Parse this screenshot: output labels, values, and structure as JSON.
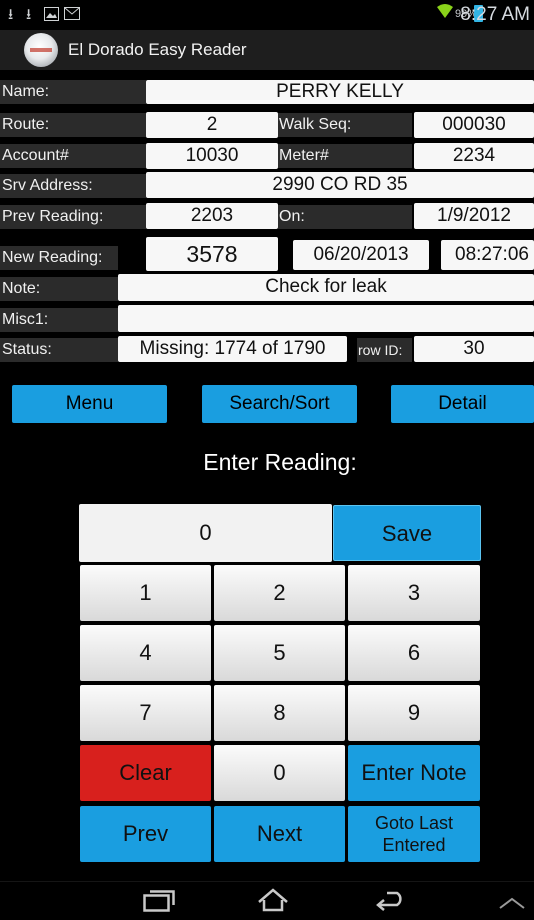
{
  "status_bar": {
    "time": "8:27 AM",
    "battery_pct": "99%",
    "icons": [
      "download-icon",
      "download-icon",
      "image-icon",
      "mail-icon"
    ]
  },
  "app": {
    "title": "El Dorado Easy Reader"
  },
  "form": {
    "name_label": "Name:",
    "name_value": "PERRY KELLY",
    "route_label": "Route:",
    "route_value": "2",
    "walkseq_label": "Walk Seq:",
    "walkseq_value": "000030",
    "account_label": "Account#",
    "account_value": "10030",
    "meter_label": "Meter#",
    "meter_value": "2234",
    "srv_label": "Srv Address:",
    "srv_value": "2990 CO RD 35",
    "prev_label": "Prev Reading:",
    "prev_value": "2203",
    "on_label": "On:",
    "on_value": "1/9/2012",
    "new_label": "New Reading:",
    "new_value": "3578",
    "new_date": "06/20/2013",
    "new_time": "08:27:06",
    "note_label": "Note:",
    "note_value": "Check for leak",
    "misc_label": "Misc1:",
    "misc_value": "",
    "status_label": "Status:",
    "status_value": "Missing: 1774 of 1790",
    "rowid_label": "row ID:",
    "rowid_value": "30"
  },
  "buttons": {
    "menu": "Menu",
    "search": "Search/Sort",
    "detail": "Detail"
  },
  "keypad": {
    "title": "Enter Reading:",
    "display": "0",
    "save": "Save",
    "k1": "1",
    "k2": "2",
    "k3": "3",
    "k4": "4",
    "k5": "5",
    "k6": "6",
    "k7": "7",
    "k8": "8",
    "k9": "9",
    "clear": "Clear",
    "k0": "0",
    "enter_note": "Enter Note",
    "prev": "Prev",
    "next": "Next",
    "goto_last": "Goto Last Entered"
  },
  "colors": {
    "accent": "#1a9ee0",
    "danger": "#d8201d"
  }
}
